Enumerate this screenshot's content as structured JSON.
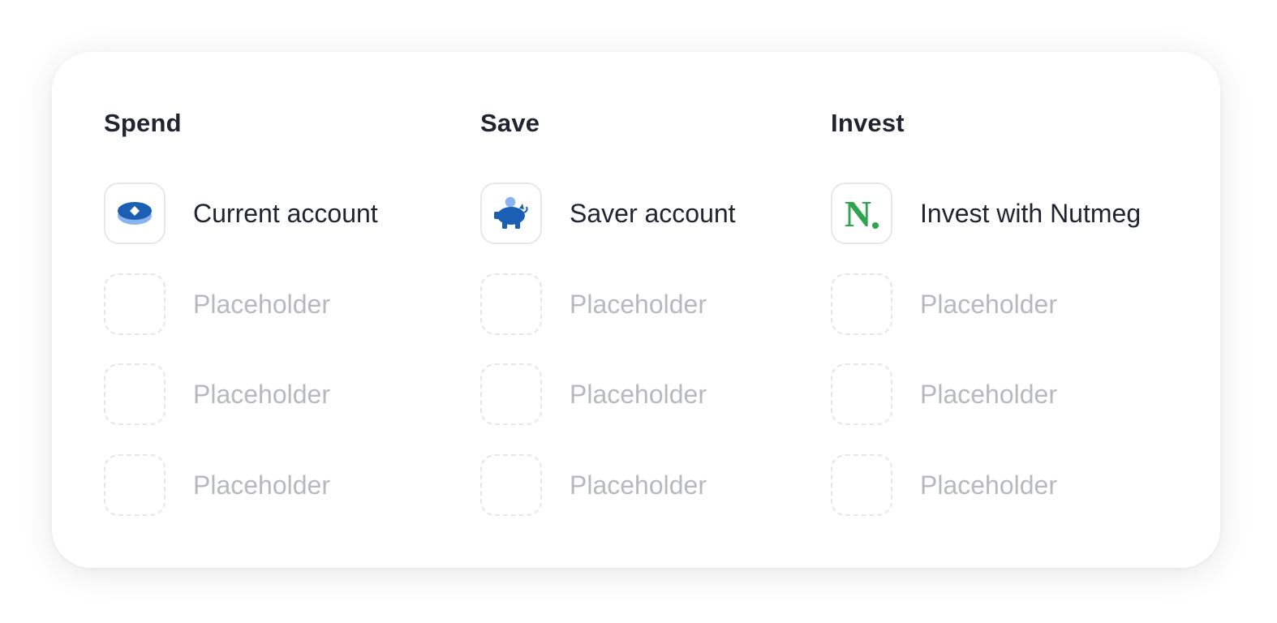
{
  "colors": {
    "brand_blue": "#1a5fb4",
    "light_blue": "#8ab4f0",
    "nutmeg_green": "#2ea44f",
    "text": "#1f2430",
    "placeholder_text": "#b7b9be"
  },
  "columns": [
    {
      "title": "Spend",
      "items": [
        {
          "label": "Current account",
          "icon": "coin-stack-icon"
        },
        {
          "label": "Placeholder",
          "icon": "placeholder-icon"
        },
        {
          "label": "Placeholder",
          "icon": "placeholder-icon"
        },
        {
          "label": "Placeholder",
          "icon": "placeholder-icon"
        }
      ]
    },
    {
      "title": "Save",
      "items": [
        {
          "label": "Saver account",
          "icon": "piggy-bank-icon"
        },
        {
          "label": "Placeholder",
          "icon": "placeholder-icon"
        },
        {
          "label": "Placeholder",
          "icon": "placeholder-icon"
        },
        {
          "label": "Placeholder",
          "icon": "placeholder-icon"
        }
      ]
    },
    {
      "title": "Invest",
      "items": [
        {
          "label": "Invest with Nutmeg",
          "icon": "nutmeg-logo-icon",
          "logo_text": "N"
        },
        {
          "label": "Placeholder",
          "icon": "placeholder-icon"
        },
        {
          "label": "Placeholder",
          "icon": "placeholder-icon"
        },
        {
          "label": "Placeholder",
          "icon": "placeholder-icon"
        }
      ]
    }
  ]
}
